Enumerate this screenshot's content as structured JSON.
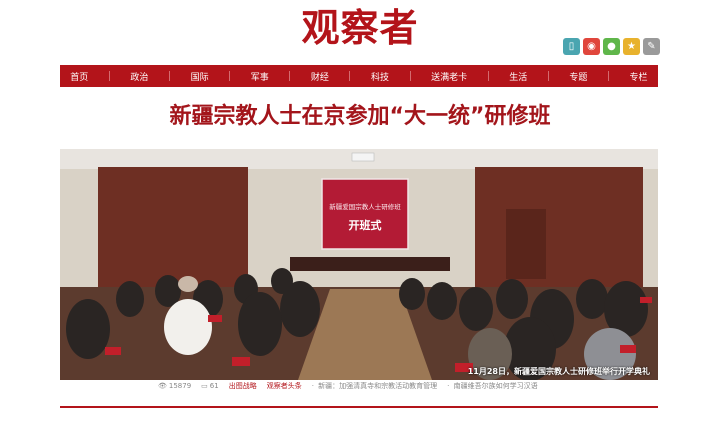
{
  "site": {
    "logo": "观察者"
  },
  "social": [
    {
      "icon": "mobile-icon",
      "color": "#4aa5b0",
      "glyph": "▯"
    },
    {
      "icon": "weibo-icon",
      "color": "#e0463c",
      "glyph": "◉"
    },
    {
      "icon": "wechat-icon",
      "color": "#5fb64a",
      "glyph": "●"
    },
    {
      "icon": "favorite-star-icon",
      "color": "#e8b22d",
      "glyph": "★"
    },
    {
      "icon": "settings-icon",
      "color": "#9a9a9a",
      "glyph": "✎"
    }
  ],
  "nav": [
    "首页",
    "政治",
    "国际",
    "军事",
    "财经",
    "科技",
    "送满老卡",
    "生活",
    "专题",
    "专栏"
  ],
  "headline": "新疆宗教人士在京参加“大一统”研修班",
  "photo": {
    "banner_title": "开班式",
    "banner_subtitle": "新疆爱国宗教人士研修班",
    "caption": "11月28日，新疆爱国宗教人士研修班举行开学典礼"
  },
  "meta": {
    "views": "15879",
    "comments": "61",
    "source": "出图战略",
    "tag": "观察者头条",
    "related": [
      "新疆：加强清真寺和宗教活动教育管理",
      "南疆维吾尔族如何学习汉语"
    ]
  },
  "colors": {
    "brand": "#b3141a"
  }
}
